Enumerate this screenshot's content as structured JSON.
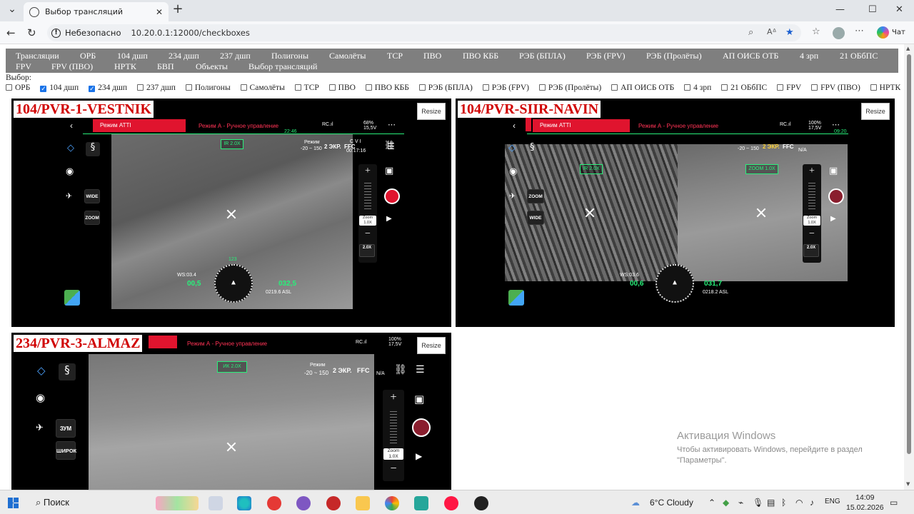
{
  "browser": {
    "tab_title": "Выбор трансляций",
    "tab_close": "✕",
    "new_tab": "+",
    "security_label": "Небезопасно",
    "url": "10.20.0.1:12000/checkboxes",
    "chat_label": "Чат",
    "window_min": "—",
    "window_max": "☐",
    "window_close": "✕"
  },
  "menu": {
    "items": [
      "Трансляции",
      "ОРБ",
      "104 дшп",
      "234 дшп",
      "237 дшп",
      "Полигоны",
      "Самолёты",
      "ТСР",
      "ПВО",
      "ПВО КББ",
      "РЭБ (БПЛА)",
      "РЭБ (FPV)",
      "РЭБ (Пролёты)",
      "АП ОИСБ ОТБ",
      "4 зрп",
      "21 ОБбПС",
      "FPV",
      "FPV (ПВО)",
      "НРТК",
      "БВП",
      "Объекты",
      "Выбор трансляций"
    ]
  },
  "selection": {
    "label": "Выбор:",
    "options": [
      {
        "label": "ОРБ",
        "checked": false
      },
      {
        "label": "104 дшп",
        "checked": true
      },
      {
        "label": "234 дшп",
        "checked": true
      },
      {
        "label": "237 дшп",
        "checked": false
      },
      {
        "label": "Полигоны",
        "checked": false
      },
      {
        "label": "Самолёты",
        "checked": false
      },
      {
        "label": "ТСР",
        "checked": false
      },
      {
        "label": "ПВО",
        "checked": false
      },
      {
        "label": "ПВО КББ",
        "checked": false
      },
      {
        "label": "РЭБ (БПЛА)",
        "checked": false
      },
      {
        "label": "РЭБ (FPV)",
        "checked": false
      },
      {
        "label": "РЭБ (Пролёты)",
        "checked": false
      },
      {
        "label": "АП ОИСБ ОТБ",
        "checked": false
      },
      {
        "label": "4 зрп",
        "checked": false
      },
      {
        "label": "21 ОБбПС",
        "checked": false
      },
      {
        "label": "FPV",
        "checked": false
      },
      {
        "label": "FPV (ПВО)",
        "checked": false
      },
      {
        "label": "НРТК",
        "checked": false
      },
      {
        "label": "БВП",
        "checked": false
      },
      {
        "label": "Объекты",
        "checked": false
      }
    ]
  },
  "streams": [
    {
      "title": "104/PVR-1-VESTNIK",
      "resize": "Resize",
      "mode_bar": "Режим ATTI",
      "control_mode": "Режим А - Ручное управление",
      "time": "22:46",
      "signal": "RC.ıl",
      "battery": "68% 15,5V",
      "ir_zoom": "IR 2.0X",
      "range_label": "Режим",
      "range": "-20 ~ 150",
      "ekr": "2 ЭКР.",
      "ffc": "FFC",
      "cvi": "C V I",
      "rec_time": "00:17:16",
      "wide": "WIDE",
      "zoom": "ZOOM",
      "zoom_val": "Zoom 1.0X",
      "ir_val": "2.0X",
      "heading": "123",
      "ws": "WS:03.4",
      "hs": "00,5",
      "alt": "032,5",
      "asl": "0219.6 ASL"
    },
    {
      "title": "104/PVR-SIIR-NAVIN",
      "resize": "Resize",
      "mode_bar": "Режим ATTI",
      "control_mode": "Режим А - Ручное управление",
      "time": "09:20",
      "signal": "RC.ıl",
      "battery": "100% 17,5V",
      "ir_zoom": "IR 2.0X",
      "zoom_box": "ZOOM 1.0X",
      "range": "-20 ~ 150",
      "ekr": "2 ЭКР.",
      "ffc": "FFC",
      "cvi": "N/A",
      "wide": "WIDE",
      "zoom": "ZOOM",
      "zoom_val": "Zoom 1.0X",
      "ir_val": "2.0X",
      "ws": "WS:03.6",
      "hs": "00,6",
      "alt": "031,7",
      "asl": "0218.2 ASL"
    },
    {
      "title": "234/PVR-3-ALMAZ",
      "resize": "Resize",
      "control_mode": "Режим А - Ручное управление",
      "signal": "RC.ıl",
      "battery": "100% 17,5V",
      "ir_zoom": "ИК 2.0X",
      "range_label": "Режим",
      "range": "-20 ~ 150",
      "ekr": "2 ЭКР.",
      "ffc": "FFC",
      "cvi": "N/A",
      "wide": "ШИРОК",
      "zoom": "ЗУМ",
      "zoom_val": "Zoom 1.0X"
    }
  ],
  "watermark": {
    "title": "Активация Windows",
    "line1": "Чтобы активировать Windows, перейдите в раздел",
    "line2": "\"Параметры\"."
  },
  "taskbar": {
    "search": "Поиск",
    "weather": "6°C Cloudy",
    "lang": "ENG",
    "time": "14:09",
    "date": "15.02.2026"
  }
}
